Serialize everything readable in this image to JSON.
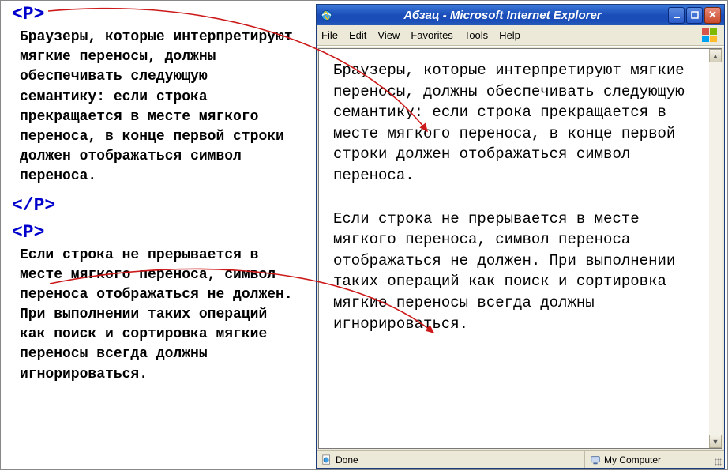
{
  "code": {
    "tag_open": "<P>",
    "tag_close": "</P>",
    "para1": "Браузеры, которые интерпретируют мягкие переносы, должны обеспечивать следующую семантику: если строка прекращается в месте мягкого переноса, в конце первой строки должен отображаться символ переноса.",
    "para2": "Если строка не прерывается в месте мягкого переноса, символ переноса отображаться не должен. При выполнении таких операций как поиск и сортировка мягкие переносы всегда должны игнорироваться."
  },
  "browser": {
    "title": "Абзац - Microsoft Internet Explorer",
    "menu": {
      "file": "File",
      "edit": "Edit",
      "view": "View",
      "favorites": "Favorites",
      "tools": "Tools",
      "help": "Help"
    },
    "content": {
      "p1": "Браузеры, которые интерпретируют мягкие переносы, должны обеспечивать следующую семантику: если строка прекращается в месте мягкого переноса, в конце первой строки должен отображаться символ переноса.",
      "p2": "Если строка не прерывается в месте мягкого переноса, символ переноса отображаться не должен. При выполнении таких операций как поиск и сортировка мягкие переносы всегда должны игнорироваться."
    },
    "status": {
      "done": "Done",
      "zone": "My Computer"
    }
  }
}
